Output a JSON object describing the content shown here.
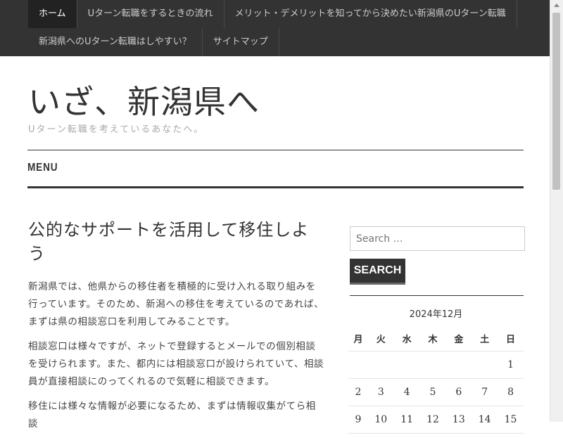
{
  "nav": {
    "row1": [
      "ホーム",
      "Uターン転職をするときの流れ",
      "メリット・デメリットを知ってから決めたい新潟県のUターン転職"
    ],
    "row2": [
      "新潟県へのUターン転職はしやすい？",
      "サイトマップ"
    ]
  },
  "site": {
    "title": "いざ、新潟県へ",
    "description": "Uターン転職を考えているあなたへ。"
  },
  "menu": {
    "label": "MENU"
  },
  "post": {
    "title": "公的なサポートを活用して移住しよう",
    "paragraphs": [
      "新潟県では、他県からの移住者を積極的に受け入れる取り組みを行っています。そのため、新潟への移住を考えているのであれば、まずは県の相談窓口を利用してみることです。",
      "相談窓口は様々ですが、ネットで登録するとメールでの個別相談を受けられます。また、都内には相談窓口が設けられていて、相談員が直接相談にのってくれるので気軽に相談できます。",
      "移住には様々な情報が必要になるため、まずは情報収集がてら相談"
    ]
  },
  "search": {
    "placeholder": "Search …",
    "button": "SEARCH"
  },
  "calendar": {
    "caption": "2024年12月",
    "weekdays": [
      "月",
      "火",
      "水",
      "木",
      "金",
      "土",
      "日"
    ],
    "weeks": [
      [
        "",
        "",
        "",
        "",
        "",
        "",
        "1"
      ],
      [
        "2",
        "3",
        "4",
        "5",
        "6",
        "7",
        "8"
      ],
      [
        "9",
        "10",
        "11",
        "12",
        "13",
        "14",
        "15"
      ]
    ]
  }
}
